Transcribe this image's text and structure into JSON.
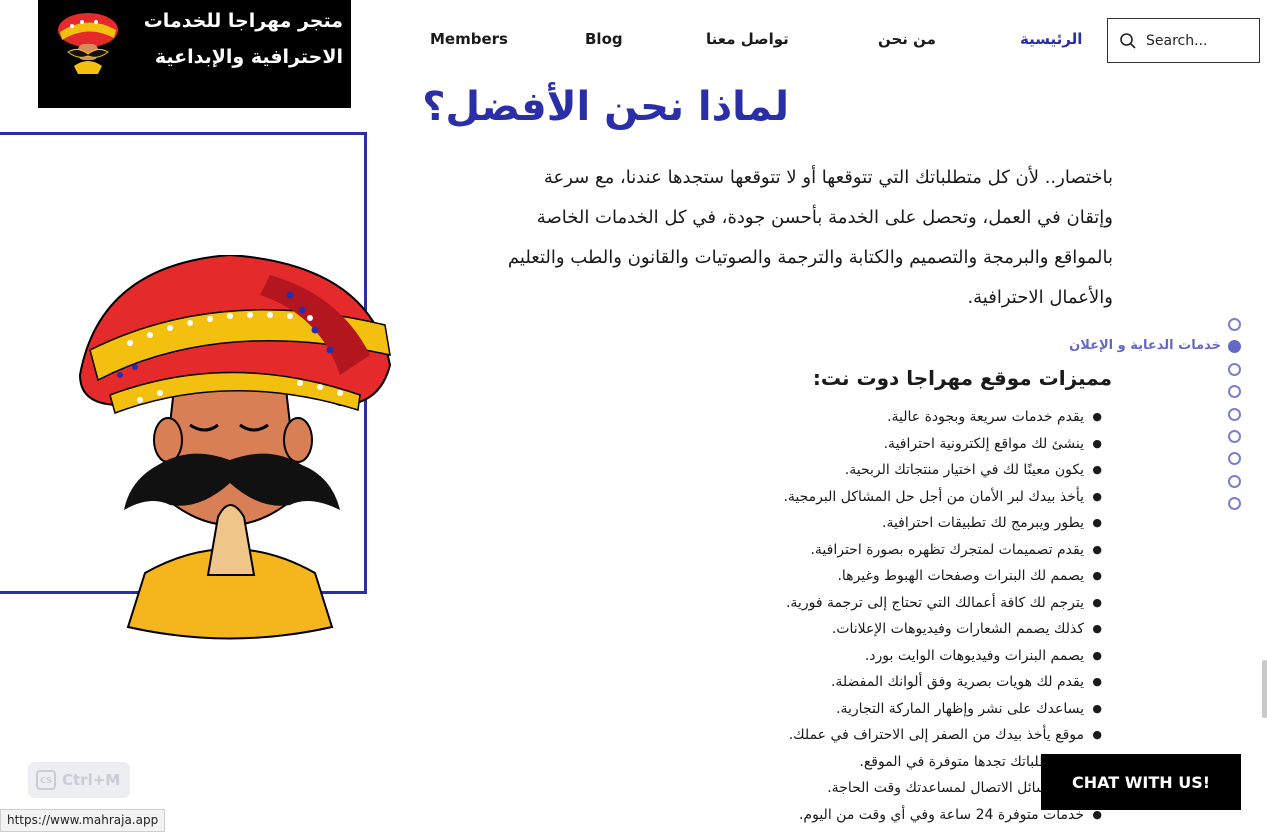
{
  "logo": {
    "line1": "متجر مهراجا للخدمات",
    "line2": "الاحترافية والإبداعية"
  },
  "nav": {
    "items": [
      {
        "label": "الرئيسية",
        "active": true
      },
      {
        "label": "من نحن"
      },
      {
        "label": "تواصل معنا"
      },
      {
        "label": "Blog"
      },
      {
        "label": "Members"
      }
    ]
  },
  "search": {
    "placeholder": "Search..."
  },
  "heading": "لماذا نحن الأفضل؟",
  "intro": "باختصار.. لأن كل متطلباتك التي تتوقعها أو لا تتوقعها ستجدها  عندنا، مع سرعة وإتقان في العمل، وتحصل على الخدمة بأحسن جودة، في كل الخدمات الخاصة  بالمواقع والبرمجة والتصميم والكتابة والترجمة والصوتيات والقانون والطب والتعليم والأعمال الاحترافية.",
  "features_title": "مميزات موقع مهراجا دوت نت:",
  "features": [
    "يقدم خدمات سريعة وبجودة عالية.",
    "ينشئ لك مواقع إلكترونية احترافية.",
    "يكون معينًا لك في اختيار منتجاتك الربحية.",
    "يأخذ بيدك لبر الأمان من أجل حل المشاكل البرمجية.",
    "يطور ويبرمج لك تطبيقات احترافية.",
    "يقدم تصميمات لمتجرك تظهره بصورة احترافية.",
    "يصمم لك البنرات وصفحات الهبوط وغيرها.",
    "يترجم لك كافة أعمالك التي تحتاج إلى ترجمة فورية.",
    "كذلك يصمم الشعارات وفيديوهات الإعلانات.",
    "يصمم البنرات وفيديوهات الوايت بورد.",
    "يقدم لك هويات بصرية وفق ألوانك المفضلة.",
    "يساعدك على نشر وإظهار الماركة التجارية.",
    "موقع يأخذ بيدك من الصفر إلى الاحتراف في عملك.",
    "كل متطلباتك تجدها متوفرة في الموقع.",
    "كافة وسائل الاتصال لمساعدتك وقت الحاجة.",
    "خدمات متوفرة 24 ساعة وفي أي وقت من اليوم."
  ],
  "side_nav": {
    "active_label": "خدمات الدعاية و الإعلان",
    "dot_count": 9,
    "active_index": 1
  },
  "chat_button": "CHAT WITH US!",
  "ctrlm": {
    "badge": "CS",
    "label": "Ctrl+M"
  },
  "status_url": "https://www.mahraja.app",
  "colors": {
    "accent": "#2a2fa8",
    "side_accent": "#6469c7"
  }
}
